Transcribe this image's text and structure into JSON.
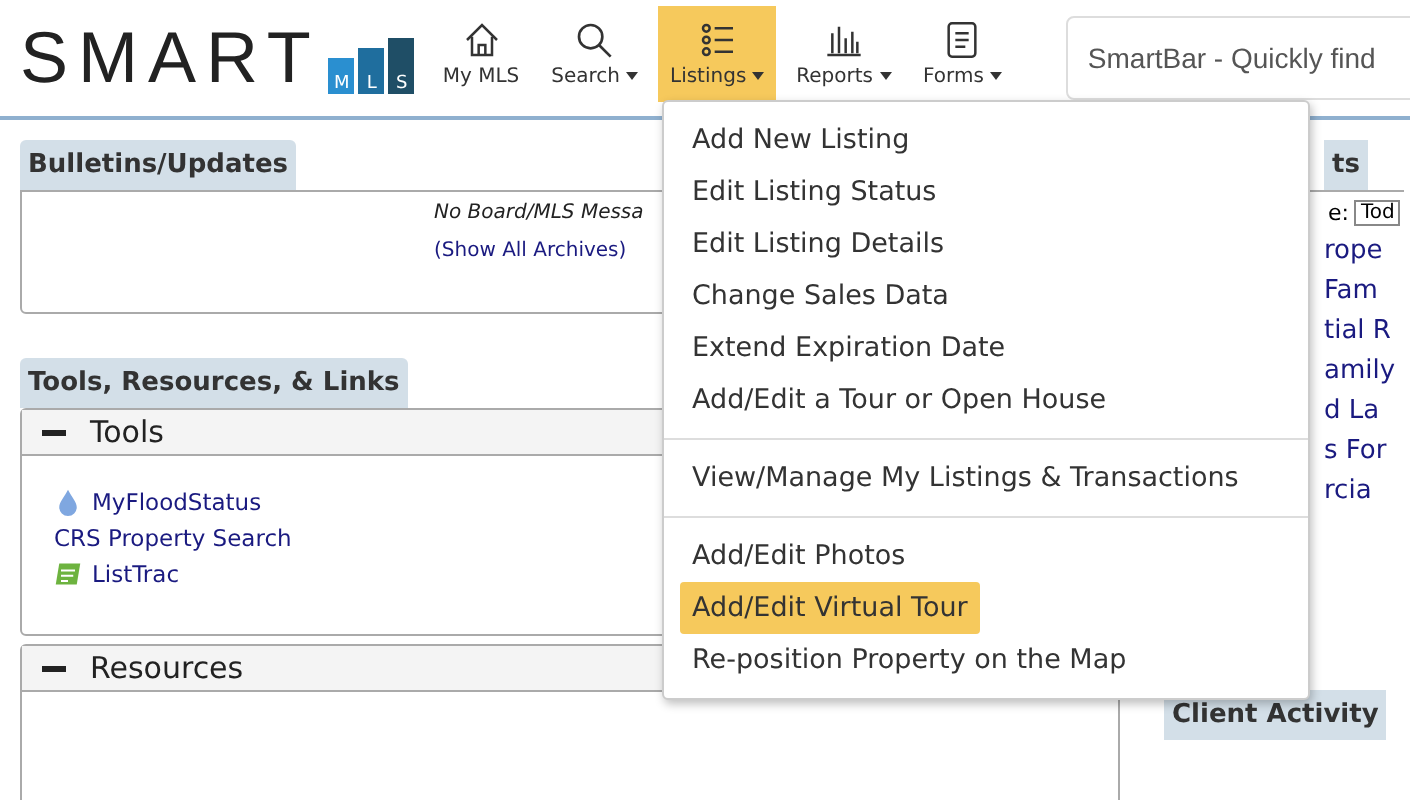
{
  "logo": {
    "word": "SMART",
    "letters": [
      "M",
      "L",
      "S"
    ]
  },
  "nav": [
    {
      "label": "My MLS",
      "dropdown": false,
      "selected": false
    },
    {
      "label": "Search",
      "dropdown": true,
      "selected": false
    },
    {
      "label": "Listings",
      "dropdown": true,
      "selected": true
    },
    {
      "label": "Reports",
      "dropdown": true,
      "selected": false
    },
    {
      "label": "Forms",
      "dropdown": true,
      "selected": false
    }
  ],
  "smartbar": {
    "placeholder": "SmartBar - Quickly find"
  },
  "bulletins": {
    "title": "Bulletins/Updates",
    "message": "No Board/MLS Messa",
    "archive_link": "(Show All Archives)"
  },
  "tools_section": {
    "title": "Tools, Resources, & Links",
    "panels": [
      {
        "title": "Tools",
        "expanded": true,
        "links": [
          "MyFloodStatus",
          "CRS Property Search",
          "ListTrac"
        ]
      },
      {
        "title": "Resources",
        "expanded": true
      }
    ]
  },
  "right_panel": {
    "title": "ts",
    "filter_label": "e:",
    "filter_value": "Tod",
    "links": [
      "rope",
      "Fam",
      "tial R",
      "amily",
      "d La",
      "s For",
      "rcia"
    ],
    "client_activity": "Client Activity"
  },
  "listings_menu": [
    [
      {
        "label": "Add New Listing",
        "selected": false
      },
      {
        "label": "Edit Listing Status",
        "selected": false
      },
      {
        "label": "Edit Listing Details",
        "selected": false
      },
      {
        "label": "Change Sales Data",
        "selected": false
      },
      {
        "label": "Extend Expiration Date",
        "selected": false
      },
      {
        "label": "Add/Edit a Tour or Open House",
        "selected": false
      }
    ],
    [
      {
        "label": "View/Manage My Listings & Transactions",
        "selected": false
      }
    ],
    [
      {
        "label": "Add/Edit Photos",
        "selected": false
      },
      {
        "label": "Add/Edit Virtual Tour",
        "selected": true
      },
      {
        "label": "Re-position Property on the Map",
        "selected": false
      }
    ]
  ]
}
